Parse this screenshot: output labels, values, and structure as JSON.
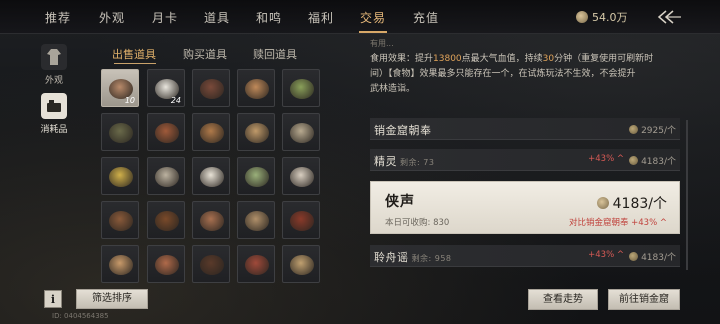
{
  "nav": {
    "tabs": [
      "推荐",
      "外观",
      "月卡",
      "道具",
      "和鸣",
      "福利",
      "交易",
      "充值"
    ],
    "active_index": 6
  },
  "currency": {
    "amount": "54.0万",
    "icon": "coin-icon"
  },
  "rail": [
    {
      "label": "外观",
      "icon": "costume-icon"
    },
    {
      "label": "消耗品",
      "icon": "consumable-icon"
    }
  ],
  "subtabs": [
    "出售道具",
    "购买道具",
    "赎回道具"
  ],
  "grid": {
    "cells": [
      {
        "qty": "10",
        "color": "#b88a6a",
        "selected": true
      },
      {
        "qty": "24",
        "color": "#e9e6de",
        "selected": false
      },
      {
        "qty": "",
        "color": "#7a4a3a",
        "selected": false
      },
      {
        "qty": "",
        "color": "#c08a5a",
        "selected": false
      },
      {
        "qty": "",
        "color": "#8aa05a",
        "selected": false
      },
      {
        "qty": "",
        "color": "#6a6a4a",
        "selected": false
      },
      {
        "qty": "",
        "color": "#a05a3a",
        "selected": false
      },
      {
        "qty": "",
        "color": "#b07a4a",
        "selected": false
      },
      {
        "qty": "",
        "color": "#c09a6a",
        "selected": false
      },
      {
        "qty": "",
        "color": "#b8aa90",
        "selected": false
      },
      {
        "qty": "",
        "color": "#d0b04a",
        "selected": false
      },
      {
        "qty": "",
        "color": "#bcb2a0",
        "selected": false
      },
      {
        "qty": "",
        "color": "#e8e2d6",
        "selected": false
      },
      {
        "qty": "",
        "color": "#9ab07a",
        "selected": false
      },
      {
        "qty": "",
        "color": "#d8cec0",
        "selected": false
      },
      {
        "qty": "",
        "color": "#8a5a3a",
        "selected": false
      },
      {
        "qty": "",
        "color": "#7a4a2a",
        "selected": false
      },
      {
        "qty": "",
        "color": "#a87050",
        "selected": false
      },
      {
        "qty": "",
        "color": "#b0906a",
        "selected": false
      },
      {
        "qty": "",
        "color": "#8a3a2a",
        "selected": false
      },
      {
        "qty": "",
        "color": "#c89a6a",
        "selected": false
      },
      {
        "qty": "",
        "color": "#b06a4a",
        "selected": false
      },
      {
        "qty": "",
        "color": "#5a3a2a",
        "selected": false
      },
      {
        "qty": "",
        "color": "#a04a3a",
        "selected": false
      },
      {
        "qty": "",
        "color": "#c0a070",
        "selected": false
      }
    ]
  },
  "bottom_left": {
    "info_label": "i",
    "filter_label": "筛选排序",
    "player_id": "ID: 0404564385"
  },
  "description": {
    "top_cut": "有用...",
    "line1_pre": "食用效果：提升",
    "line1_num1": "13800",
    "line1_mid": "点最大气血值，持续",
    "line1_num2": "30",
    "line1_post": "分钟（重复使用可刷新时",
    "line2": "间）【食物】效果最多只能存在一个，在试炼玩法不生效，不会提升",
    "line3": "武林造诣。"
  },
  "listings": [
    {
      "title": "销金窟朝奉",
      "sub": "",
      "pct": "",
      "price": "2925/个"
    },
    {
      "title": "精灵",
      "sub": "剩余: 73",
      "pct": "+43% ^",
      "price": "4183/个"
    },
    {
      "title": "聆舟谣",
      "sub": "剩余: 958",
      "pct": "+43% ^",
      "price": "4183/个"
    }
  ],
  "selected_listing": {
    "title": "侠声",
    "sub": "本日可收购: 830",
    "price": "4183/个",
    "compare": "对比销金窟朝奉 +43% ^"
  },
  "actions": {
    "view_trend": "查看走势",
    "goto": "前往销金窟"
  }
}
